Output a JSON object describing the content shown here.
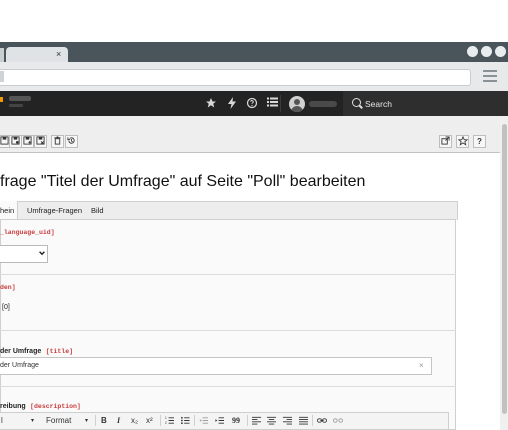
{
  "browser": {
    "tab_close": "×",
    "menu_icon": "hamburger-menu-icon"
  },
  "topbar": {
    "icons": [
      "star-icon",
      "bolt-icon",
      "help-icon",
      "list-icon"
    ],
    "search_label": "Search"
  },
  "docheader": {
    "left_buttons": [
      "save-icon",
      "save-view-icon",
      "save-new-icon",
      "save-close-icon",
      "delete-icon",
      "history-icon"
    ],
    "right_buttons": [
      "open-new-window-icon",
      "bookmark-icon",
      "help-icon"
    ]
  },
  "page": {
    "title": "frage \"Titel der Umfrage\" auf Seite \"Poll\" bearbeiten"
  },
  "tabs": [
    {
      "label": "hein"
    },
    {
      "label": "Umfrage-Fragen"
    },
    {
      "label": "Bild"
    }
  ],
  "fields": {
    "language": {
      "code": "_language_uid]"
    },
    "hidden": {
      "code": "den]",
      "value": "[0]"
    },
    "title": {
      "label": "der Umfrage",
      "code": "[title]",
      "value": "der Umfrage",
      "clear": "×"
    },
    "description": {
      "label": "reibung",
      "code": "[description]"
    }
  },
  "rte": {
    "style_partial": "l",
    "format_label": "Format",
    "bold": "B",
    "italic": "I",
    "subscript": "x₂",
    "superscript": "x²",
    "quote": "99"
  }
}
